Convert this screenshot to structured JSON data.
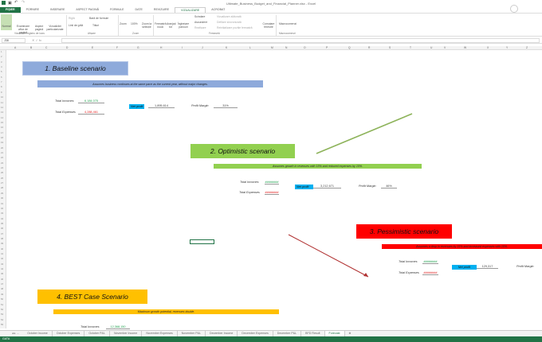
{
  "window": {
    "title": "Ultimate_Business_Budget_and_Financial_Planner.xlsx - Excel"
  },
  "ribbon_tabs": [
    "FIȘIER",
    "PORNIRE",
    "INSERARE",
    "ASPECT PAGINĂ",
    "FORMULE",
    "DATE",
    "REVIZUIRE",
    "VIZUALIZARE",
    "ACROBAT"
  ],
  "ribbon": {
    "buttons": [
      "Normal",
      "Examinare aflux de pagină",
      "Aspect pagină",
      "Vizualizări particularizate",
      "Riglă",
      "Bară de formule",
      "Linii de grilă",
      "Titluri",
      "Zoom",
      "100%",
      "Zoom la selecție",
      "Fereastră nouă",
      "Aranjați tot",
      "Înghețare panouri",
      "Scindare",
      "Ascundere",
      "Reafișare",
      "Vizualizare alăturată",
      "Defilare sincronizată",
      "Reinițializare poziție fereastră",
      "Comutare ferestre",
      "Macrocomenzi"
    ],
    "groups": [
      "Vizualizări registru de lucru",
      "Afișare",
      "Zoom",
      "Fereastră",
      "Macrocomenzi"
    ]
  },
  "formula_bar": {
    "name_box": "J38",
    "value": ""
  },
  "columns": [
    "A",
    "B",
    "C",
    "D",
    "E",
    "F",
    "G",
    "H",
    "I",
    "J",
    "K",
    "L",
    "M",
    "N",
    "O",
    "P",
    "Q",
    "R",
    "S",
    "T",
    "U",
    "V",
    "W",
    "X",
    "Y",
    "Z"
  ],
  "scenarios": [
    {
      "title": "1. Baseline scenario",
      "desc": "Assumes business continues at the same pace as the current year, without major changes.",
      "incomes_label": "Total Incomes",
      "incomes": "6,184,075",
      "expenses_label": "Total Expenses",
      "expenses": "4,288,461",
      "net_label": "Net profit",
      "net": "1,895,614",
      "margin_label": "Profit Margin",
      "margin": "31%",
      "color": "#8eaadb"
    },
    {
      "title": "2. Optimistic scenario",
      "desc": "Assumes growth in revenues with 15% and reduced expenses by 10%.",
      "incomes_label": "Total Incomes",
      "incomes": "########",
      "expenses_label": "Total Expenses",
      "expenses": "########",
      "net_label": "Net profit",
      "net": "3,212,671",
      "margin_label": "Profit Margin",
      "margin": "46%",
      "color": "#92d050"
    },
    {
      "title": "3. Pessimistic scenario",
      "desc": "Assumes a drop in revenues by 15% and increased expenses with 10%.",
      "incomes_label": "Total Incomes",
      "incomes": "########",
      "expenses_label": "Total Expenses",
      "expenses": "########",
      "net_label": "Net profit",
      "net": "129,317",
      "margin_label": "Profit Margin",
      "color": "#ff0000"
    },
    {
      "title": "4. BEST Case Scenario",
      "desc": "Maximum growth potential, revenues double.",
      "incomes_label": "Total Incomes",
      "incomes": "12,368,150",
      "color": "#ffc000"
    }
  ],
  "sheet_tabs": [
    "October Income",
    "October Expenses",
    "October P&L",
    "November Income",
    "November Expenses",
    "November P&L",
    "December Income",
    "December Expenses",
    "December P&L",
    "BFD Result",
    "Forecast"
  ],
  "status": "GATA"
}
